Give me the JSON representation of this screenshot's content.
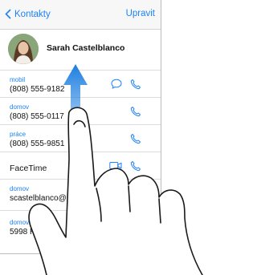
{
  "navbar": {
    "back_label": "Kontakty",
    "edit_label": "Upravit"
  },
  "contact": {
    "name": "Sarah Castelblanco"
  },
  "fields": {
    "mobile": {
      "label": "mobil",
      "value": "(808) 555-9182"
    },
    "home": {
      "label": "domov",
      "value": "(808) 555-0117"
    },
    "work": {
      "label": "práce",
      "value": "(808) 555-9851"
    },
    "facetime": {
      "value": "FaceTime"
    },
    "email": {
      "label": "domov",
      "value": "scastelblanco@me.com"
    },
    "address": {
      "label": "domov",
      "value": "5998 Hawaiian Moon St, Hilo, HI"
    }
  },
  "colors": {
    "accent": "#1a82fb",
    "arrow": "#1e7fe0"
  },
  "icons": [
    "chevron-left-icon",
    "message-icon",
    "phone-icon",
    "video-icon",
    "scroll-arrow-icon",
    "hand-icon"
  ]
}
